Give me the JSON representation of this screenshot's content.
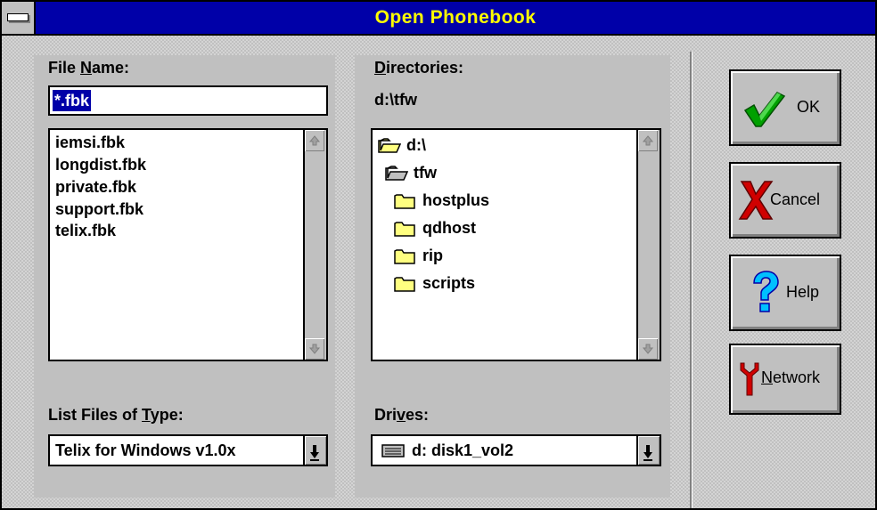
{
  "window": {
    "title": "Open Phonebook"
  },
  "file_name": {
    "label_pre": "File ",
    "label_mn": "N",
    "label_post": "ame:",
    "value": "*.fbk"
  },
  "files": [
    {
      "name": "iemsi.fbk"
    },
    {
      "name": "longdist.fbk"
    },
    {
      "name": "private.fbk"
    },
    {
      "name": "support.fbk"
    },
    {
      "name": "telix.fbk"
    }
  ],
  "file_type": {
    "label_pre": "List Files of ",
    "label_mn": "T",
    "label_post": "ype:",
    "value": "Telix for Windows v1.0x"
  },
  "directories": {
    "label_mn": "D",
    "label_post": "irectories:",
    "current_path": "d:\\tfw",
    "items": [
      {
        "name": "d:\\",
        "icon": "open-folder-icon"
      },
      {
        "name": "tfw",
        "icon": "open-folder-icon"
      },
      {
        "name": "hostplus",
        "icon": "closed-folder-icon"
      },
      {
        "name": "qdhost",
        "icon": "closed-folder-icon"
      },
      {
        "name": "rip",
        "icon": "closed-folder-icon"
      },
      {
        "name": "scripts",
        "icon": "closed-folder-icon"
      }
    ]
  },
  "drives": {
    "label_pre": "Dri",
    "label_mn": "v",
    "label_post": "es:",
    "value": "d: disk1_vol2",
    "icon": "hard-drive-icon"
  },
  "buttons": {
    "ok": "OK",
    "cancel": "Cancel",
    "help": "Help",
    "network_mn": "N",
    "network_post": "etwork"
  },
  "colors": {
    "title_bg": "#0000a8",
    "title_text": "#ffff00",
    "face": "#c0c0c0",
    "selection": "#0000a8",
    "folder_yellow": "#ffff80",
    "ok_check": "#00a000",
    "cancel_x": "#d00000",
    "help_q": "#00c0ff"
  }
}
